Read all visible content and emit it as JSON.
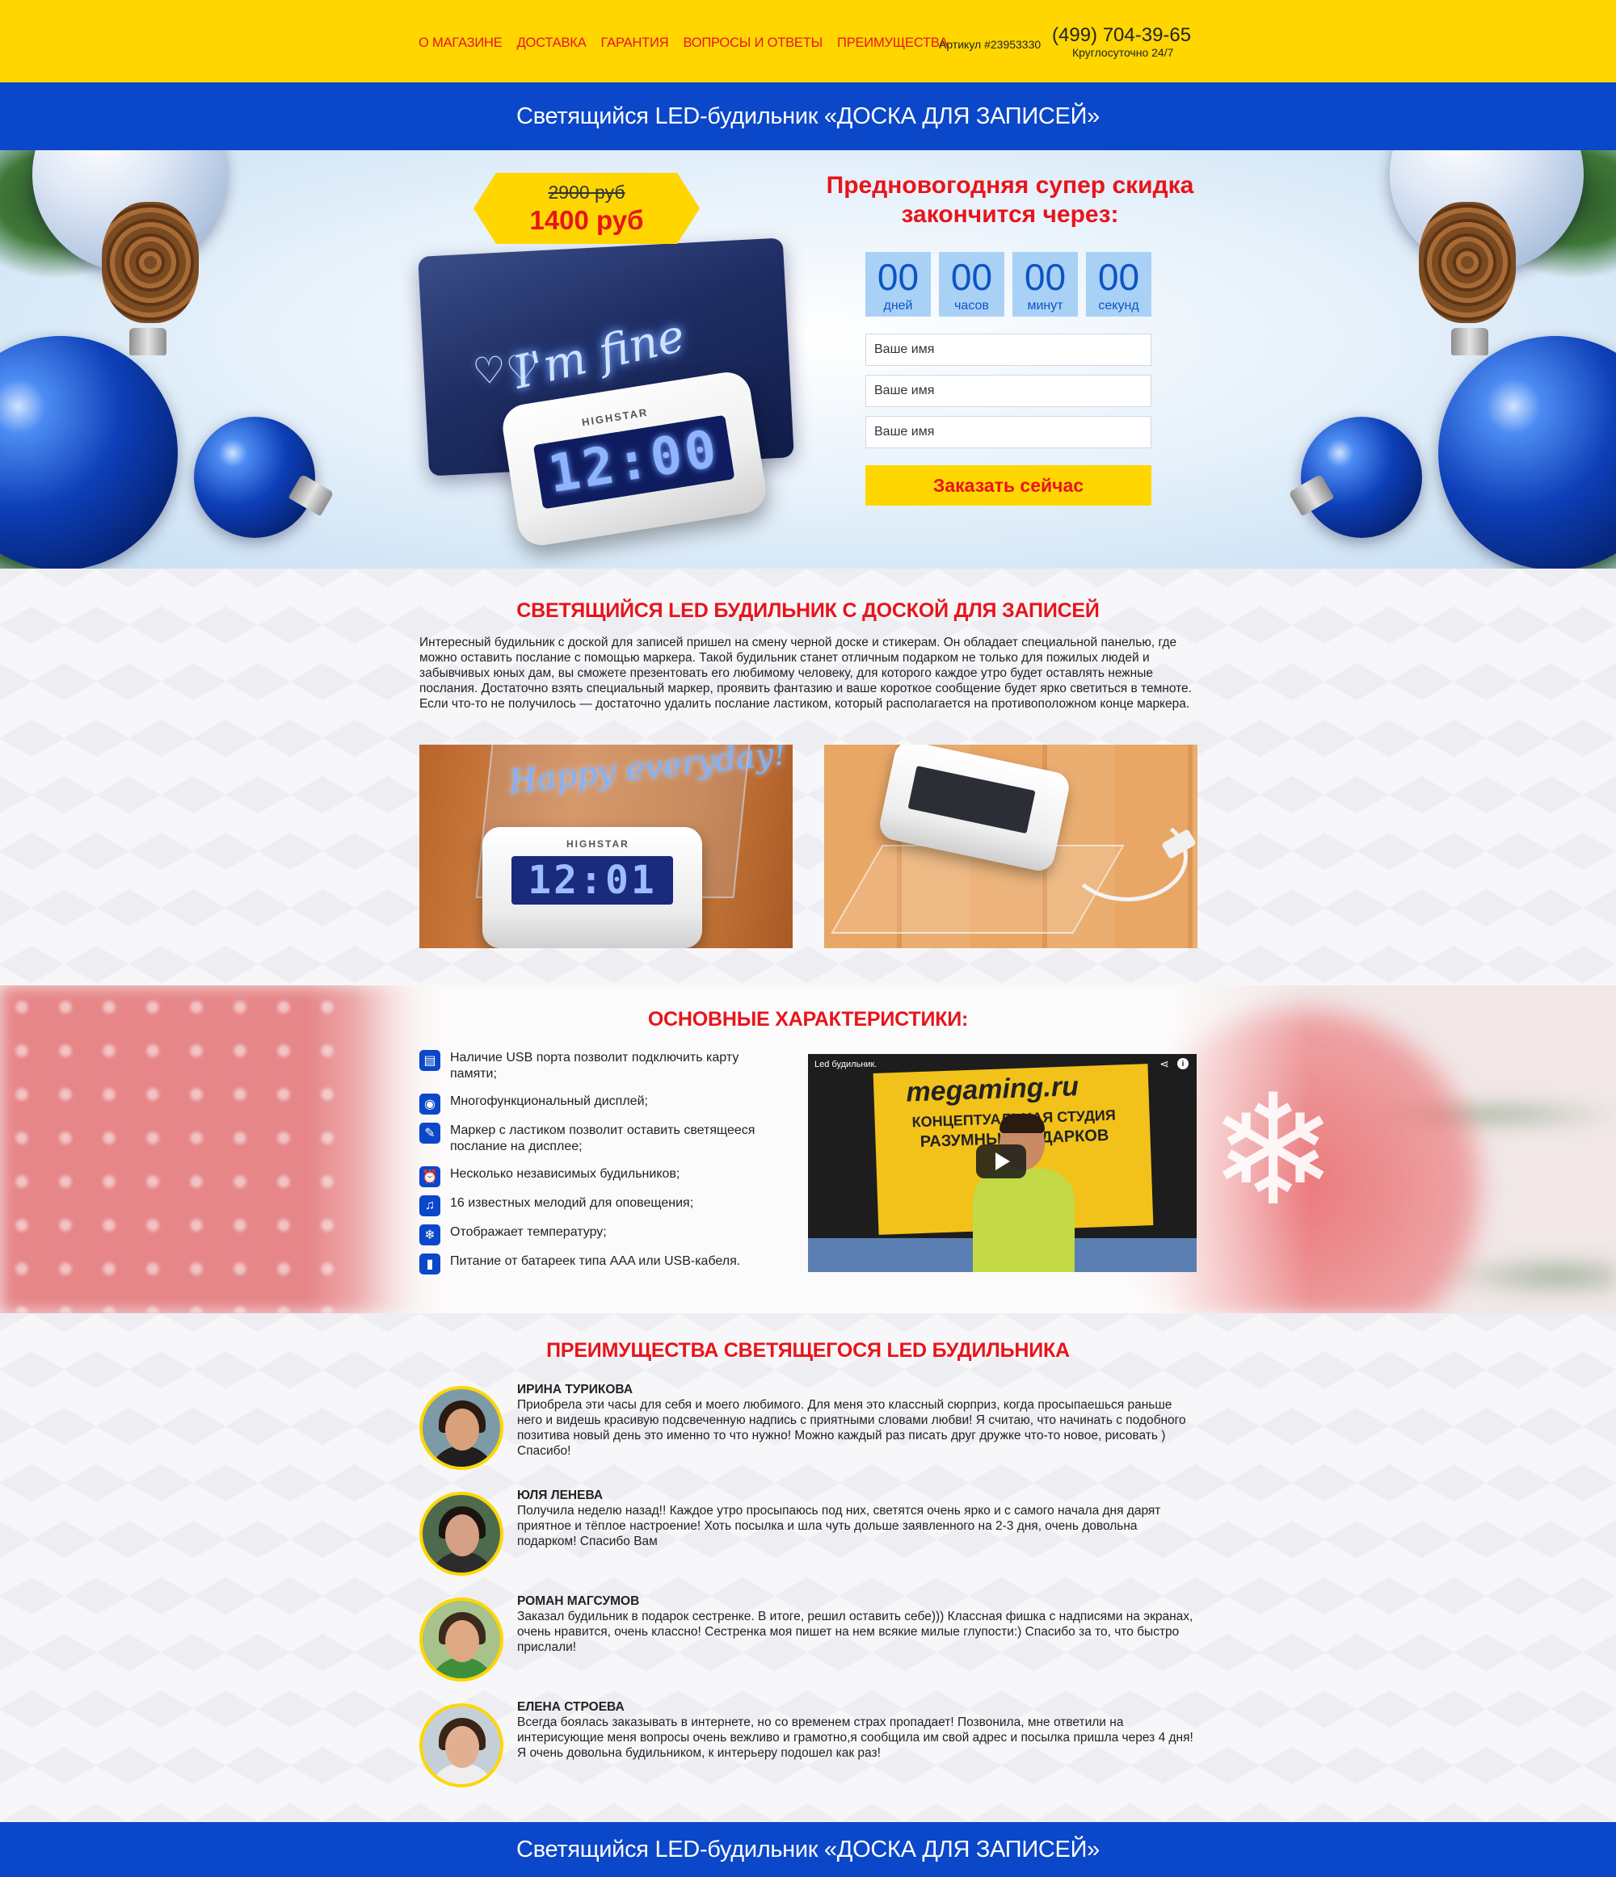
{
  "header": {
    "nav": [
      "О МАГАЗИНЕ",
      "ДОСТАВКА",
      "ГАРАНТИЯ",
      "ВОПРОСЫ И ОТВЕТЫ",
      "ПРЕИМУЩЕСТВА"
    ],
    "article": "Артикул #23953330",
    "phone": "(499) 704-39-65",
    "phone_note": "Круглосуточно 24/7"
  },
  "banner_title": "Светящийся LED-будильник «ДОСКА ДЛЯ ЗАПИСЕЙ»",
  "hero": {
    "price_old": "2900 руб",
    "price_new": "1400 руб",
    "offer_title": "Предновогодняя супер скидка закончится через:",
    "timer": [
      {
        "value": "00",
        "label": "дней"
      },
      {
        "value": "00",
        "label": "часов"
      },
      {
        "value": "00",
        "label": "минут"
      },
      {
        "value": "00",
        "label": "секунд"
      }
    ],
    "fields": [
      "Ваше имя",
      "Ваше имя",
      "Ваше имя"
    ],
    "order_button": "Заказать сейчас",
    "board_text": "I'm fine",
    "clock_brand": "HIGHSTAR",
    "clock_time": "12:00"
  },
  "description": {
    "title": "СВЕТЯЩИЙСЯ LED БУДИЛЬНИК С ДОСКОЙ ДЛЯ ЗАПИСЕЙ",
    "text": "Интересный будильник с доской для записей пришел на смену черной доске и стикерам. Он обладает специальной панелью, где можно оставить послание с помощью маркера. Такой будильник станет отличным подарком не только для пожилых людей и забывчивых юных дам, вы сможете презентовать его любимому человеку, для которого каждое утро будет оставлять нежные послания. Достаточно взять специальный маркер, проявить фантазию и ваше короткое сообщение будет ярко светиться в темноте. Если что-то не получилось — достаточно удалить послание ластиком, который располагается на противоположном конце маркера.",
    "photo1_sign": "Happy everyday!",
    "photo1_brand": "HIGHSTAR",
    "photo1_time": "12:01"
  },
  "characteristics": {
    "title": "ОСНОВНЫЕ ХАРАКТЕРИСТИКИ:",
    "items": [
      {
        "icon": "sd-card-icon",
        "text": "Наличие USB порта позволит подключить карту памяти;"
      },
      {
        "icon": "eye-icon",
        "text": "Многофункциональный дисплей;"
      },
      {
        "icon": "eraser-icon",
        "text": "Маркер с ластиком позволит оставить светящееся послание на дисплее;"
      },
      {
        "icon": "alarm-clock-icon",
        "text": "Несколько независимых будильников;"
      },
      {
        "icon": "music-note-icon",
        "text": "16 известных мелодий для оповещения;"
      },
      {
        "icon": "snowflake-thermometer-icon",
        "text": "Отображает температуру;"
      },
      {
        "icon": "battery-icon",
        "text": "Питание от батареек типа AAA или USB-кабеля."
      }
    ],
    "video": {
      "title": "Led будильник.",
      "banner_brand": "megaming.ru",
      "banner_line1": "КОНЦЕПТУАЛЬНАЯ СТУДИЯ",
      "banner_line2": "РАЗУМНЫХ ПОДАРКОВ"
    }
  },
  "reviews": {
    "title": "ПРЕИМУЩЕСТВА СВЕТЯЩЕГОСЯ LED БУДИЛЬНИКА",
    "items": [
      {
        "name": "ИРИНА ТУРИКОВА",
        "text": "Приобрела эти часы для себя и моего любимого. Для меня это классный сюрприз, когда просыпаешься раньше него и видешь красивую подсвеченную надпись с приятными словами любви! Я считаю, что начинать с подобного позитива новый день это именно то что нужно! Можно каждый раз писать друг дружке что-то новое, рисовать ) Спасибо!"
      },
      {
        "name": "ЮЛЯ ЛЕНЕВА",
        "text": "Получила неделю назад!! Каждое утро просыпаюсь под них, светятся очень ярко и с самого начала дня дарят приятное и тёплое настроение! Хоть посылка и шла чуть дольше заявленного на 2-3 дня, очень довольна подарком! Спасибо Вам"
      },
      {
        "name": "РОМАН МАГСУМОВ",
        "text": "Заказал будильник в подарок сестренке. В итоге, решил оставить себе))) Классная фишка с надписями на экранах, очень нравится, очень классно! Сестренка моя пишет на нем всякие милые глупости:) Спасибо за то, что быстро прислали!"
      },
      {
        "name": "ЕЛЕНА СТРОЕВА",
        "text": "Всегда боялась заказывать в интернете, но со временем страх пропадает! Позвонила, мне ответили на интерисующие меня вопросы очень вежливо и грамотно,я сообщила им свой адрес и посылка пришла через 4 дня! Я очень довольна будильником, к интерьеру подошел как раз!"
      }
    ]
  },
  "colors": {
    "accent_red": "#e8141b",
    "brand_yellow": "#ffd600",
    "brand_blue": "#0a47c9",
    "timer_box": "#a9d1f6"
  }
}
